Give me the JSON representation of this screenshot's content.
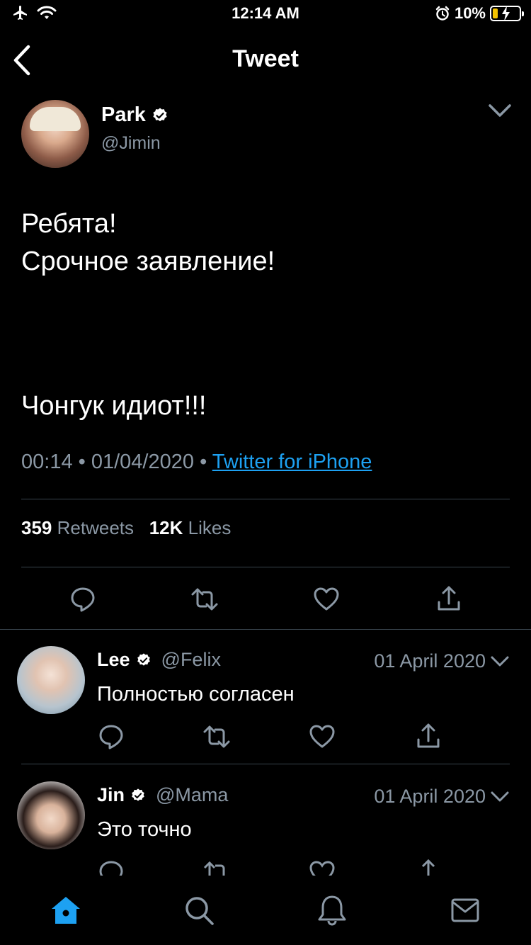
{
  "status_bar": {
    "time": "12:14 AM",
    "battery_percent": "10%",
    "icons": [
      "airplane-icon",
      "wifi-icon",
      "alarm-icon",
      "battery-charging-icon"
    ]
  },
  "header": {
    "title": "Tweet",
    "back_icon": "chevron-left-icon"
  },
  "tweet": {
    "author_name": "Park",
    "author_handle": "@Jimin",
    "verified": true,
    "text_lines": [
      "Ребята!",
      "Срочное заявление!"
    ],
    "text_line_after_gap": "Чонгук идиот!!!",
    "time": "00:14",
    "date": "01/04/2020",
    "separator": "•",
    "source": "Twitter for iPhone",
    "retweets_count": "359",
    "retweets_label": "Retweets",
    "likes_count": "12K",
    "likes_label": "Likes"
  },
  "replies": [
    {
      "name": "Lee",
      "handle": "@Felix",
      "verified": true,
      "date": "01 April 2020",
      "text": "Полностью согласен"
    },
    {
      "name": "Jin",
      "handle": "@Mama",
      "verified": true,
      "date": "01 April 2020",
      "text": "Это точно"
    }
  ],
  "tab_bar": {
    "items": [
      "home-icon",
      "search-icon",
      "notifications-icon",
      "messages-icon"
    ],
    "active": "home-icon"
  },
  "colors": {
    "background": "#000000",
    "accent": "#1da1f2",
    "secondary_text": "#8b98a5",
    "divider": "#38444d"
  }
}
